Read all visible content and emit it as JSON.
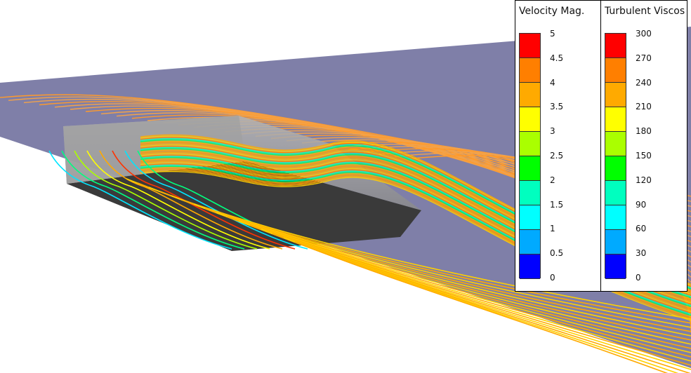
{
  "scene": {
    "plane_color": "#7f7fa8",
    "body_top_color": "#9a9a9a",
    "body_side_color": "#3a3a3a"
  },
  "legends": {
    "velocity": {
      "title": "Velocity Mag.",
      "ticks": [
        "5",
        "4.5",
        "4",
        "3.5",
        "3",
        "2.5",
        "2",
        "1.5",
        "1",
        "0.5",
        "0"
      ],
      "colors": [
        "#ff0000",
        "#ff7f00",
        "#ffaa00",
        "#ffff00",
        "#aaff00",
        "#00ff00",
        "#00ffbf",
        "#00ffff",
        "#00aaff",
        "#0000ff"
      ]
    },
    "turbulent_viscosity": {
      "title": "Turbulent Viscos",
      "ticks": [
        "300",
        "270",
        "240",
        "210",
        "180",
        "150",
        "120",
        "90",
        "60",
        "30",
        "0"
      ],
      "colors": [
        "#ff0000",
        "#ff7f00",
        "#ffaa00",
        "#ffff00",
        "#aaff00",
        "#00ff00",
        "#00ffbf",
        "#00ffff",
        "#00aaff",
        "#0000ff"
      ]
    }
  }
}
